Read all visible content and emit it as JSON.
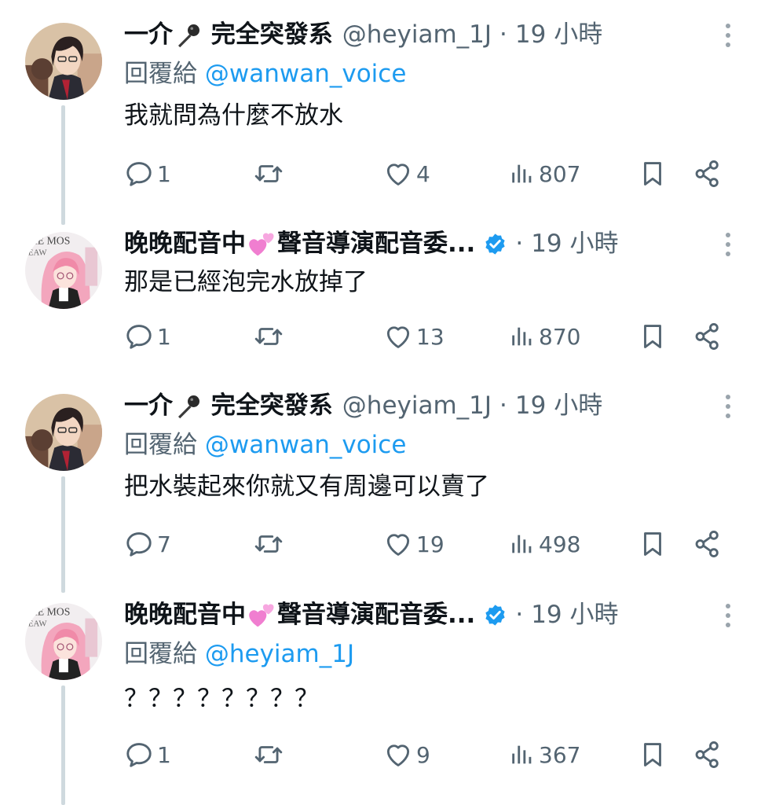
{
  "reply_prefix": "回覆給",
  "tweets": [
    {
      "name_a": "一介",
      "name_b": "完全突發系",
      "handle": "@heyiam_1J",
      "dot": "·",
      "time": "19 小時",
      "reply_to": "@wanwan_voice",
      "text": "我就問為什麼不放水",
      "replies": "1",
      "reposts": "",
      "likes": "4",
      "views": "807"
    },
    {
      "name_a": "晚晚配音中",
      "name_b": "聲音導演配音委...",
      "handle": "",
      "dot": "·",
      "time": "19 小時",
      "reply_to": "",
      "text": "那是已經泡完水放掉了",
      "replies": "1",
      "reposts": "",
      "likes": "13",
      "views": "870"
    },
    {
      "name_a": "一介",
      "name_b": "完全突發系",
      "handle": "@heyiam_1J",
      "dot": "·",
      "time": "19 小時",
      "reply_to": "@wanwan_voice",
      "text": "把水裝起來你就又有周邊可以賣了",
      "replies": "7",
      "reposts": "",
      "likes": "19",
      "views": "498"
    },
    {
      "name_a": "晚晚配音中",
      "name_b": "聲音導演配音委...",
      "handle": "",
      "dot": "·",
      "time": "19 小時",
      "reply_to": "@heyiam_1J",
      "text": "？？？？？？？？",
      "replies": "1",
      "reposts": "",
      "likes": "9",
      "views": "367"
    }
  ],
  "colors": {
    "secondary": "#536471",
    "link": "#1d9bf0",
    "verified": "#1d9bf0",
    "thread_line": "#cfd9de"
  },
  "icons": [
    "reply-icon",
    "repost-icon",
    "like-icon",
    "views-icon",
    "bookmark-icon",
    "share-icon",
    "more-icon",
    "verified-icon",
    "microphone-icon",
    "two-hearts-icon"
  ]
}
